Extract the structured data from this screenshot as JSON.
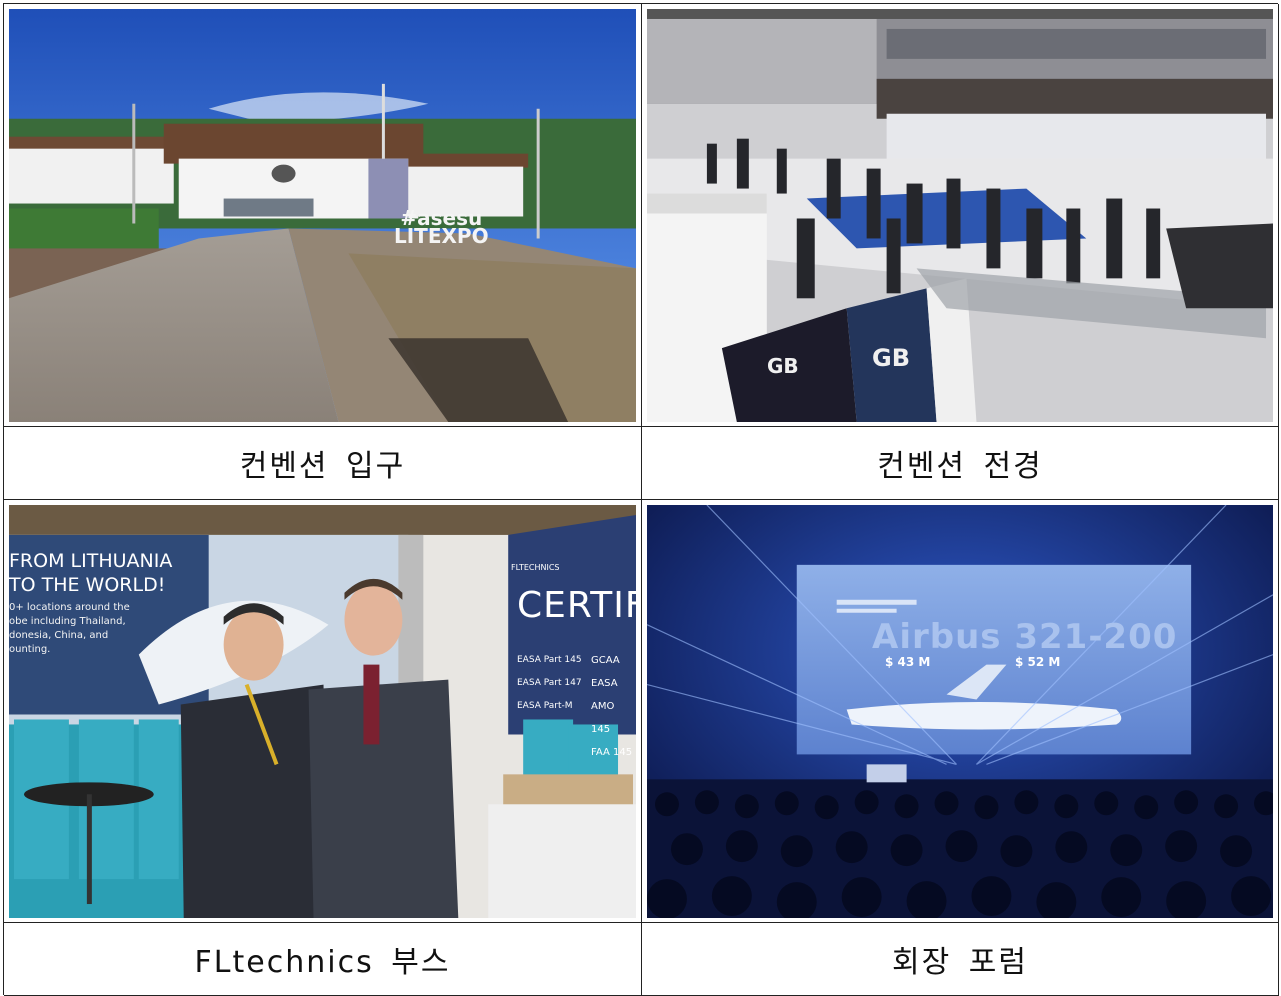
{
  "photos": [
    {
      "caption": "컨벤션 입구",
      "sign_lines": [
        "#asesu",
        "LITEXPO"
      ]
    },
    {
      "caption": "컨벤션 전경",
      "sign_lines": [
        "GB",
        "GB"
      ]
    },
    {
      "caption": "FLtechnics 부스",
      "sign_lines": [
        "FROM LITHUANIA",
        "TO THE WORLD!",
        "0+ locations around the",
        "obe including Thailand,",
        "donesia, China, and",
        "ounting.",
        "FLTECHNICS",
        "CERTIFI",
        "EASA Part 145",
        "EASA Part 147",
        "EASA Part-M",
        "GCAA EASA",
        "AMO 145",
        "FAA 145"
      ]
    },
    {
      "caption": "회장 포럼",
      "sign_lines": [
        "Airbus 321-200",
        "$ 43 M",
        "$ 52 M"
      ]
    }
  ]
}
